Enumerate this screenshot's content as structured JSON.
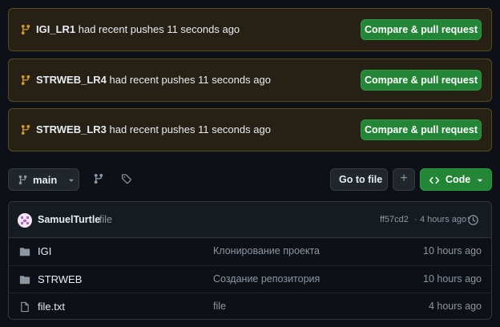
{
  "banners": [
    {
      "branch": "IGI_LR1",
      "text": "had recent pushes 11 seconds ago",
      "button": "Compare & pull request"
    },
    {
      "branch": "STRWEB_LR4",
      "text": "had recent pushes 11 seconds ago",
      "button": "Compare & pull request"
    },
    {
      "branch": "STRWEB_LR3",
      "text": "had recent pushes 11 seconds ago",
      "button": "Compare & pull request"
    }
  ],
  "toolbar": {
    "branch": "main",
    "go_to_file": "Go to file",
    "add": "+",
    "code": "Code"
  },
  "commit": {
    "author": "SamuelTurtle",
    "message": "file",
    "hash": "ff57cd2",
    "separator": "·",
    "age": "4 hours ago"
  },
  "files": [
    {
      "type": "folder",
      "name": "IGI",
      "message": "Клонирование проекта",
      "age": "10 hours ago"
    },
    {
      "type": "folder",
      "name": "STRWEB",
      "message": "Создание репозитория",
      "age": "10 hours ago"
    },
    {
      "type": "file",
      "name": "file.txt",
      "message": "file",
      "age": "4 hours ago"
    }
  ],
  "colors": {
    "accent_green": "#238636",
    "banner_bg": "#272115",
    "banner_icon": "#d29922"
  }
}
